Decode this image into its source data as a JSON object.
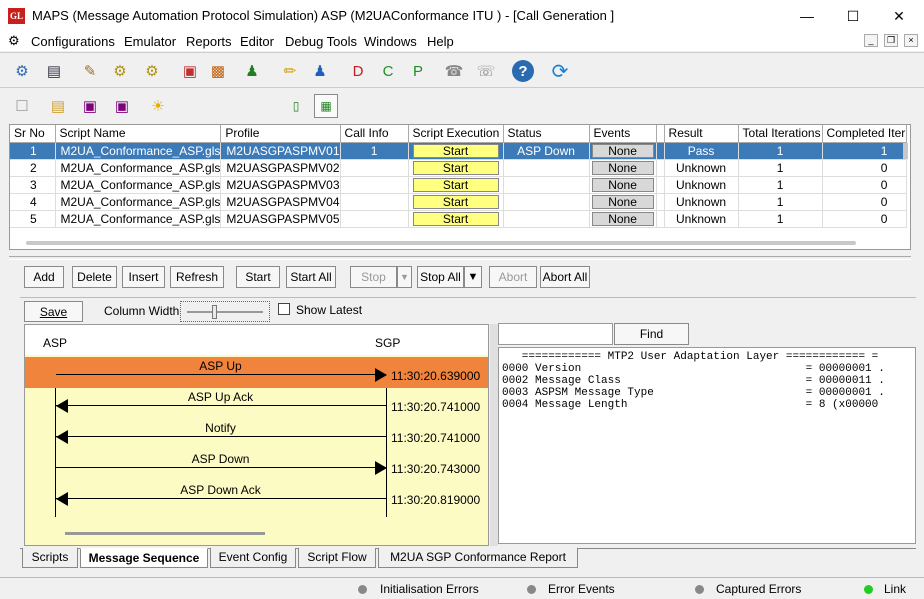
{
  "window": {
    "title": "MAPS (Message Automation Protocol Simulation) ASP (M2UAConformance ITU ) - [Call Generation  ]",
    "logo": "GL"
  },
  "menu": [
    "Configurations",
    "Emulator",
    "Reports",
    "Editor",
    "Debug Tools",
    "Windows",
    "Help"
  ],
  "grid": {
    "columns": [
      "Sr No",
      "Script Name",
      "Profile",
      "Call Info",
      "Script Execution",
      "Status",
      "Events",
      "Result",
      "Total Iterations",
      "Completed Iter"
    ],
    "rows": [
      {
        "sr": "1",
        "script": "M2UA_Conformance_ASP.gls",
        "profile": "M2UASGPASPMV01",
        "call": "1",
        "exec": "Start",
        "status": "ASP Down",
        "events": "None",
        "result": "Pass",
        "total": "1",
        "completed": "1"
      },
      {
        "sr": "2",
        "script": "M2UA_Conformance_ASP.gls",
        "profile": "M2UASGPASPMV02",
        "call": "",
        "exec": "Start",
        "status": "",
        "events": "None",
        "result": "Unknown",
        "total": "1",
        "completed": "0"
      },
      {
        "sr": "3",
        "script": "M2UA_Conformance_ASP.gls",
        "profile": "M2UASGPASPMV03",
        "call": "",
        "exec": "Start",
        "status": "",
        "events": "None",
        "result": "Unknown",
        "total": "1",
        "completed": "0"
      },
      {
        "sr": "4",
        "script": "M2UA_Conformance_ASP.gls",
        "profile": "M2UASGPASPMV04",
        "call": "",
        "exec": "Start",
        "status": "",
        "events": "None",
        "result": "Unknown",
        "total": "1",
        "completed": "0"
      },
      {
        "sr": "5",
        "script": "M2UA_Conformance_ASP.gls",
        "profile": "M2UASGPASPMV05",
        "call": "",
        "exec": "Start",
        "status": "",
        "events": "None",
        "result": "Unknown",
        "total": "1",
        "completed": "0"
      }
    ]
  },
  "buttons": {
    "add": "Add",
    "delete": "Delete",
    "insert": "Insert",
    "refresh": "Refresh",
    "start": "Start",
    "start_all": "Start All",
    "stop": "Stop",
    "stop_all": "Stop All",
    "abort": "Abort",
    "abort_all": "Abort All"
  },
  "seqbar": {
    "save": "Save",
    "column_width": "Column Width",
    "show_latest": "Show Latest"
  },
  "find": {
    "label": "Find",
    "value": ""
  },
  "sequence": {
    "left": "ASP",
    "right": "SGP",
    "messages": [
      {
        "label": "ASP Up",
        "time": "11:30:20.639000",
        "dir": "right"
      },
      {
        "label": "ASP Up Ack",
        "time": "11:30:20.741000",
        "dir": "left"
      },
      {
        "label": "Notify",
        "time": "11:30:20.741000",
        "dir": "left"
      },
      {
        "label": "ASP Down",
        "time": "11:30:20.743000",
        "dir": "right"
      },
      {
        "label": "ASP Down Ack",
        "time": "11:30:20.819000",
        "dir": "left"
      }
    ]
  },
  "detail": {
    "lines": [
      "   ============ MTP2 User Adaptation Layer ============ =",
      "0000 Version                                  = 00000001 .",
      "0002 Message Class                            = 00000011 .",
      "0003 ASPSM Message Type                       = 00000001 .",
      "0004 Message Length                           = 8 (x00000"
    ]
  },
  "tabs": [
    "Scripts",
    "Message Sequence",
    "Event Config",
    "Script Flow",
    "M2UA SGP Conformance Report"
  ],
  "status": {
    "init": "Initialisation Errors",
    "events": "Error Events",
    "captured": "Captured Errors",
    "link": "Link"
  },
  "colors": {
    "selected_row": "#3d7ab8",
    "start_cell": "#ffff80",
    "highlight_msg": "#f0843c",
    "sequence_bg": "#fdfbc4",
    "link_led": "#22cc22"
  }
}
